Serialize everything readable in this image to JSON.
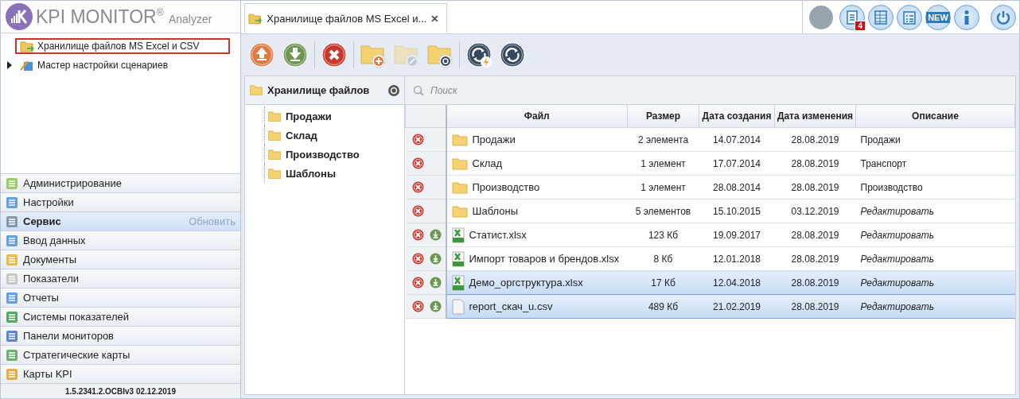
{
  "logo": {
    "brand": "KPI MONITOR",
    "mark": "®",
    "product": "Analyzer"
  },
  "nav_tree": [
    {
      "label": "Хранилище файлов MS Excel и CSV",
      "selected": true,
      "kind": "storage"
    },
    {
      "label": "Мастер настройки сценариев",
      "selected": false,
      "expanded": false,
      "kind": "wizard"
    }
  ],
  "sections": [
    {
      "label": "Администрирование",
      "kind": "admin",
      "selected": false
    },
    {
      "label": "Настройки",
      "kind": "settings",
      "selected": false
    },
    {
      "label": "Сервис",
      "kind": "service",
      "selected": true,
      "action": "Обновить"
    },
    {
      "label": "Ввод данных",
      "kind": "input",
      "selected": false
    },
    {
      "label": "Документы",
      "kind": "docs",
      "selected": false
    },
    {
      "label": "Показатели",
      "kind": "gauge",
      "selected": false
    },
    {
      "label": "Отчеты",
      "kind": "grid",
      "selected": false
    },
    {
      "label": "Системы показателей",
      "kind": "tree",
      "selected": false
    },
    {
      "label": "Панели мониторов",
      "kind": "panels",
      "selected": false
    },
    {
      "label": "Стратегические карты",
      "kind": "map",
      "selected": false
    },
    {
      "label": "Карты KPI",
      "kind": "kpi",
      "selected": false
    }
  ],
  "version": "1.5.2341.2.OCBIv3  02.12.2019",
  "tabs": [
    {
      "label": "Хранилище файлов MS Excel и...",
      "selected": true
    }
  ],
  "toolbar": [
    {
      "kind": "upload",
      "disabled": false
    },
    {
      "kind": "download",
      "disabled": false
    },
    {
      "kind": "sep"
    },
    {
      "kind": "delete",
      "disabled": false
    },
    {
      "kind": "sep"
    },
    {
      "kind": "folder-add",
      "disabled": false
    },
    {
      "kind": "folder-edit",
      "disabled": true
    },
    {
      "kind": "folder-refresh",
      "disabled": false
    },
    {
      "kind": "sep"
    },
    {
      "kind": "refresh-flash",
      "disabled": false
    },
    {
      "kind": "refresh",
      "disabled": false
    }
  ],
  "top_icons": [
    {
      "kind": "notes",
      "badge": "4"
    },
    {
      "kind": "table"
    },
    {
      "kind": "checklist"
    },
    {
      "kind": "new",
      "label": "NEW"
    },
    {
      "kind": "info"
    },
    {
      "kind": "power"
    }
  ],
  "folder_tree": {
    "title": "Хранилище файлов",
    "children": [
      {
        "label": "Продажи"
      },
      {
        "label": "Склад"
      },
      {
        "label": "Производство"
      },
      {
        "label": "Шаблоны"
      }
    ]
  },
  "search": {
    "placeholder": "Поиск"
  },
  "table": {
    "columns": [
      "Файл",
      "Размер",
      "Дата создания",
      "Дата изменения",
      "Описание"
    ],
    "rows": [
      {
        "kind": "folder",
        "name": "Продажи",
        "size": "2 элемента",
        "created": "14.07.2014",
        "modified": "28.08.2019",
        "description": "Продажи",
        "description_placeholder": false,
        "selected": false
      },
      {
        "kind": "folder",
        "name": "Склад",
        "size": "1 элемент",
        "created": "17.07.2014",
        "modified": "28.08.2019",
        "description": "Транспорт",
        "description_placeholder": false,
        "selected": false
      },
      {
        "kind": "folder",
        "name": "Производство",
        "size": "1 элемент",
        "created": "28.08.2014",
        "modified": "28.08.2019",
        "description": "Производство",
        "description_placeholder": false,
        "selected": false
      },
      {
        "kind": "folder",
        "name": "Шаблоны",
        "size": "5 элементов",
        "created": "15.10.2015",
        "modified": "03.12.2019",
        "description": "Редактировать",
        "description_placeholder": true,
        "selected": false
      },
      {
        "kind": "xlsx",
        "name": "Статист.xlsx",
        "size": "123 Кб",
        "created": "19.09.2017",
        "modified": "28.08.2019",
        "description": "Редактировать",
        "description_placeholder": true,
        "selected": false
      },
      {
        "kind": "xlsx",
        "name": "Импорт товаров и брендов.xlsx",
        "size": "8 Кб",
        "created": "12.01.2018",
        "modified": "28.08.2019",
        "description": "Редактировать",
        "description_placeholder": true,
        "selected": false
      },
      {
        "kind": "xlsx",
        "name": "Демо_оргструктура.xlsx",
        "size": "17 Кб",
        "created": "12.04.2018",
        "modified": "28.08.2019",
        "description": "Редактировать",
        "description_placeholder": true,
        "selected": true
      },
      {
        "kind": "csv",
        "name": "report_скач_u.csv",
        "size": "489 Кб",
        "created": "21.02.2019",
        "modified": "28.08.2019",
        "description": "Редактировать",
        "description_placeholder": true,
        "selected": true
      }
    ]
  }
}
